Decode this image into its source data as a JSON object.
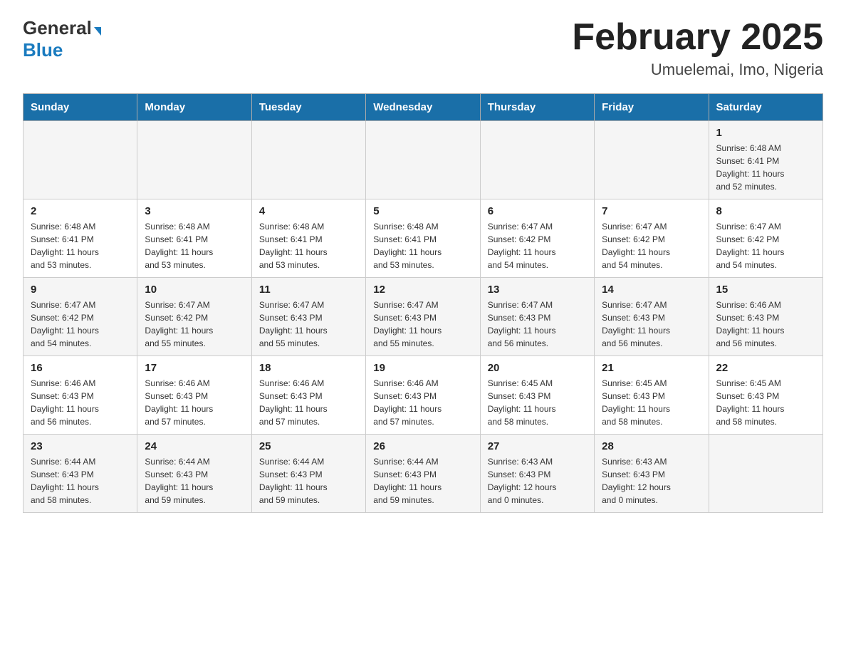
{
  "header": {
    "logo_general": "General",
    "logo_blue": "Blue",
    "title": "February 2025",
    "subtitle": "Umuelemai, Imo, Nigeria"
  },
  "weekdays": [
    "Sunday",
    "Monday",
    "Tuesday",
    "Wednesday",
    "Thursday",
    "Friday",
    "Saturday"
  ],
  "weeks": [
    [
      {
        "day": "",
        "info": ""
      },
      {
        "day": "",
        "info": ""
      },
      {
        "day": "",
        "info": ""
      },
      {
        "day": "",
        "info": ""
      },
      {
        "day": "",
        "info": ""
      },
      {
        "day": "",
        "info": ""
      },
      {
        "day": "1",
        "info": "Sunrise: 6:48 AM\nSunset: 6:41 PM\nDaylight: 11 hours\nand 52 minutes."
      }
    ],
    [
      {
        "day": "2",
        "info": "Sunrise: 6:48 AM\nSunset: 6:41 PM\nDaylight: 11 hours\nand 53 minutes."
      },
      {
        "day": "3",
        "info": "Sunrise: 6:48 AM\nSunset: 6:41 PM\nDaylight: 11 hours\nand 53 minutes."
      },
      {
        "day": "4",
        "info": "Sunrise: 6:48 AM\nSunset: 6:41 PM\nDaylight: 11 hours\nand 53 minutes."
      },
      {
        "day": "5",
        "info": "Sunrise: 6:48 AM\nSunset: 6:41 PM\nDaylight: 11 hours\nand 53 minutes."
      },
      {
        "day": "6",
        "info": "Sunrise: 6:47 AM\nSunset: 6:42 PM\nDaylight: 11 hours\nand 54 minutes."
      },
      {
        "day": "7",
        "info": "Sunrise: 6:47 AM\nSunset: 6:42 PM\nDaylight: 11 hours\nand 54 minutes."
      },
      {
        "day": "8",
        "info": "Sunrise: 6:47 AM\nSunset: 6:42 PM\nDaylight: 11 hours\nand 54 minutes."
      }
    ],
    [
      {
        "day": "9",
        "info": "Sunrise: 6:47 AM\nSunset: 6:42 PM\nDaylight: 11 hours\nand 54 minutes."
      },
      {
        "day": "10",
        "info": "Sunrise: 6:47 AM\nSunset: 6:42 PM\nDaylight: 11 hours\nand 55 minutes."
      },
      {
        "day": "11",
        "info": "Sunrise: 6:47 AM\nSunset: 6:43 PM\nDaylight: 11 hours\nand 55 minutes."
      },
      {
        "day": "12",
        "info": "Sunrise: 6:47 AM\nSunset: 6:43 PM\nDaylight: 11 hours\nand 55 minutes."
      },
      {
        "day": "13",
        "info": "Sunrise: 6:47 AM\nSunset: 6:43 PM\nDaylight: 11 hours\nand 56 minutes."
      },
      {
        "day": "14",
        "info": "Sunrise: 6:47 AM\nSunset: 6:43 PM\nDaylight: 11 hours\nand 56 minutes."
      },
      {
        "day": "15",
        "info": "Sunrise: 6:46 AM\nSunset: 6:43 PM\nDaylight: 11 hours\nand 56 minutes."
      }
    ],
    [
      {
        "day": "16",
        "info": "Sunrise: 6:46 AM\nSunset: 6:43 PM\nDaylight: 11 hours\nand 56 minutes."
      },
      {
        "day": "17",
        "info": "Sunrise: 6:46 AM\nSunset: 6:43 PM\nDaylight: 11 hours\nand 57 minutes."
      },
      {
        "day": "18",
        "info": "Sunrise: 6:46 AM\nSunset: 6:43 PM\nDaylight: 11 hours\nand 57 minutes."
      },
      {
        "day": "19",
        "info": "Sunrise: 6:46 AM\nSunset: 6:43 PM\nDaylight: 11 hours\nand 57 minutes."
      },
      {
        "day": "20",
        "info": "Sunrise: 6:45 AM\nSunset: 6:43 PM\nDaylight: 11 hours\nand 58 minutes."
      },
      {
        "day": "21",
        "info": "Sunrise: 6:45 AM\nSunset: 6:43 PM\nDaylight: 11 hours\nand 58 minutes."
      },
      {
        "day": "22",
        "info": "Sunrise: 6:45 AM\nSunset: 6:43 PM\nDaylight: 11 hours\nand 58 minutes."
      }
    ],
    [
      {
        "day": "23",
        "info": "Sunrise: 6:44 AM\nSunset: 6:43 PM\nDaylight: 11 hours\nand 58 minutes."
      },
      {
        "day": "24",
        "info": "Sunrise: 6:44 AM\nSunset: 6:43 PM\nDaylight: 11 hours\nand 59 minutes."
      },
      {
        "day": "25",
        "info": "Sunrise: 6:44 AM\nSunset: 6:43 PM\nDaylight: 11 hours\nand 59 minutes."
      },
      {
        "day": "26",
        "info": "Sunrise: 6:44 AM\nSunset: 6:43 PM\nDaylight: 11 hours\nand 59 minutes."
      },
      {
        "day": "27",
        "info": "Sunrise: 6:43 AM\nSunset: 6:43 PM\nDaylight: 12 hours\nand 0 minutes."
      },
      {
        "day": "28",
        "info": "Sunrise: 6:43 AM\nSunset: 6:43 PM\nDaylight: 12 hours\nand 0 minutes."
      },
      {
        "day": "",
        "info": ""
      }
    ]
  ]
}
